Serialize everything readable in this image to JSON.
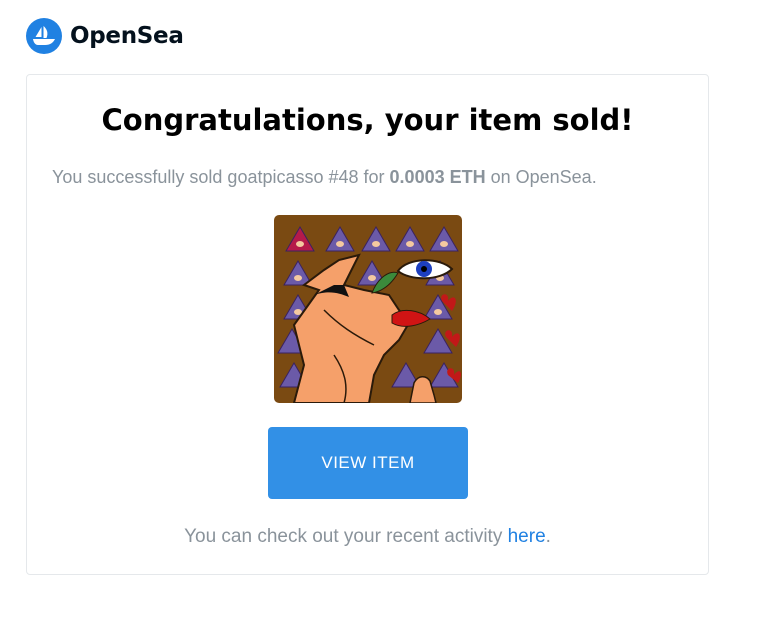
{
  "brand": {
    "name": "OpenSea",
    "icon": "opensea-logo-icon",
    "color": "#2081e2"
  },
  "email": {
    "title": "Congratulations, your item sold!",
    "message": {
      "prefix": "You successfully sold goatpicasso #48 for ",
      "price": "0.0003 ETH",
      "suffix": " on OpenSea."
    },
    "image": {
      "alt": "goatpicasso #48",
      "background_color": "#7a4a12"
    },
    "button_label": "VIEW ITEM",
    "button_color": "#3290e6",
    "footer": {
      "prefix": "You can check out your recent activity ",
      "link_text": "here",
      "suffix": "."
    }
  }
}
